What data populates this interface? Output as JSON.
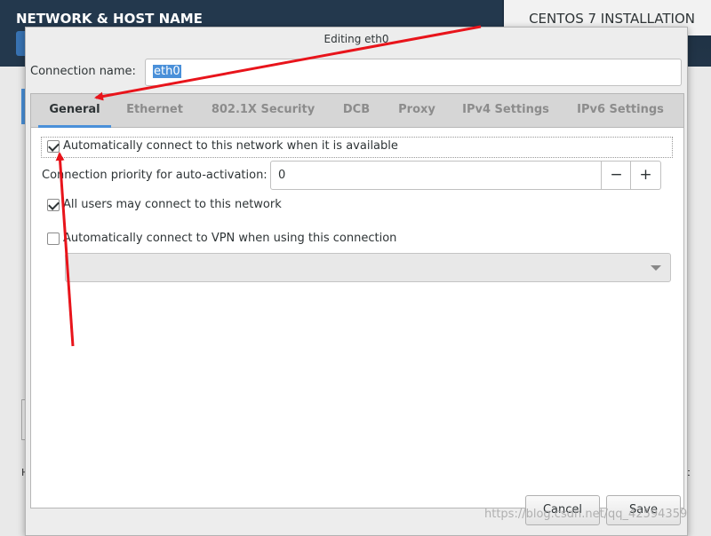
{
  "installer": {
    "section_title": "NETWORK & HOST NAME",
    "product_title": "CENTOS 7 INSTALLATION",
    "bottom_left_char": "H",
    "bottom_right_char": "t"
  },
  "dialog": {
    "title": "Editing eth0",
    "connection_name_label": "Connection name:",
    "connection_name_value": "eth0",
    "tabs": [
      {
        "label": "General",
        "active": true
      },
      {
        "label": "Ethernet",
        "active": false
      },
      {
        "label": "802.1X Security",
        "active": false
      },
      {
        "label": "DCB",
        "active": false
      },
      {
        "label": "Proxy",
        "active": false
      },
      {
        "label": "IPv4 Settings",
        "active": false
      },
      {
        "label": "IPv6 Settings",
        "active": false
      }
    ],
    "general": {
      "auto_connect_label": "Automatically connect to this network when it is available",
      "auto_connect_checked": true,
      "priority_label": "Connection priority for auto-activation:",
      "priority_value": "0",
      "minus_label": "−",
      "plus_label": "+",
      "all_users_label": "All users may connect to this network",
      "all_users_checked": true,
      "vpn_label": "Automatically connect to VPN when using this connection",
      "vpn_checked": false,
      "vpn_select_value": ""
    },
    "buttons": {
      "cancel": "Cancel",
      "save": "Save"
    }
  },
  "annotation_color": "#e8141b",
  "watermark": "https://blog.csdn.net/qq_42594359"
}
